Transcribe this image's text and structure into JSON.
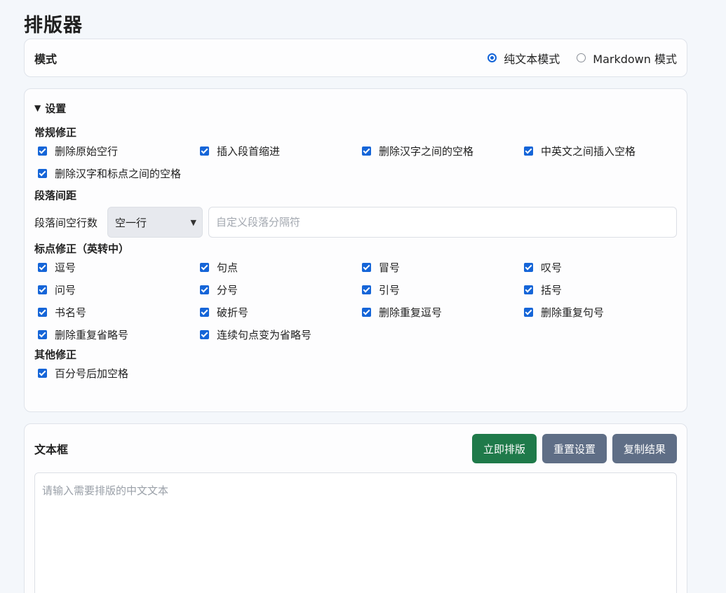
{
  "page": {
    "title": "排版器"
  },
  "mode": {
    "label": "模式",
    "options": [
      {
        "label": "纯文本模式",
        "selected": true
      },
      {
        "label": "Markdown 模式",
        "selected": false
      }
    ]
  },
  "settings": {
    "summary": "设置",
    "general": {
      "title": "常规修正",
      "items": [
        {
          "label": "删除原始空行",
          "checked": true
        },
        {
          "label": "插入段首缩进",
          "checked": true
        },
        {
          "label": "删除汉字之间的空格",
          "checked": true
        },
        {
          "label": "中英文之间插入空格",
          "checked": true
        },
        {
          "label": "删除汉字和标点之间的空格",
          "checked": true
        }
      ]
    },
    "spacing": {
      "title": "段落间距",
      "label": "段落间空行数",
      "select_value": "空一行",
      "custom_placeholder": "自定义段落分隔符"
    },
    "punctuation": {
      "title": "标点修正（英转中）",
      "items": [
        {
          "label": "逗号",
          "checked": true
        },
        {
          "label": "句点",
          "checked": true
        },
        {
          "label": "冒号",
          "checked": true
        },
        {
          "label": "叹号",
          "checked": true
        },
        {
          "label": "问号",
          "checked": true
        },
        {
          "label": "分号",
          "checked": true
        },
        {
          "label": "引号",
          "checked": true
        },
        {
          "label": "括号",
          "checked": true
        },
        {
          "label": "书名号",
          "checked": true
        },
        {
          "label": "破折号",
          "checked": true
        },
        {
          "label": "删除重复逗号",
          "checked": true
        },
        {
          "label": "删除重复句号",
          "checked": true
        },
        {
          "label": "删除重复省略号",
          "checked": true
        },
        {
          "label": "连续句点变为省略号",
          "checked": true
        }
      ]
    },
    "other": {
      "title": "其他修正",
      "items": [
        {
          "label": "百分号后加空格",
          "checked": true
        }
      ]
    }
  },
  "textbox": {
    "label": "文本框",
    "buttons": {
      "format": "立即排版",
      "reset": "重置设置",
      "copy": "复制结果"
    },
    "placeholder": "请输入需要排版的中文文本",
    "value": ""
  },
  "colors": {
    "accent": "#1565d8",
    "primary_button": "#1f7a4a",
    "secondary_button": "#5f6e86"
  }
}
